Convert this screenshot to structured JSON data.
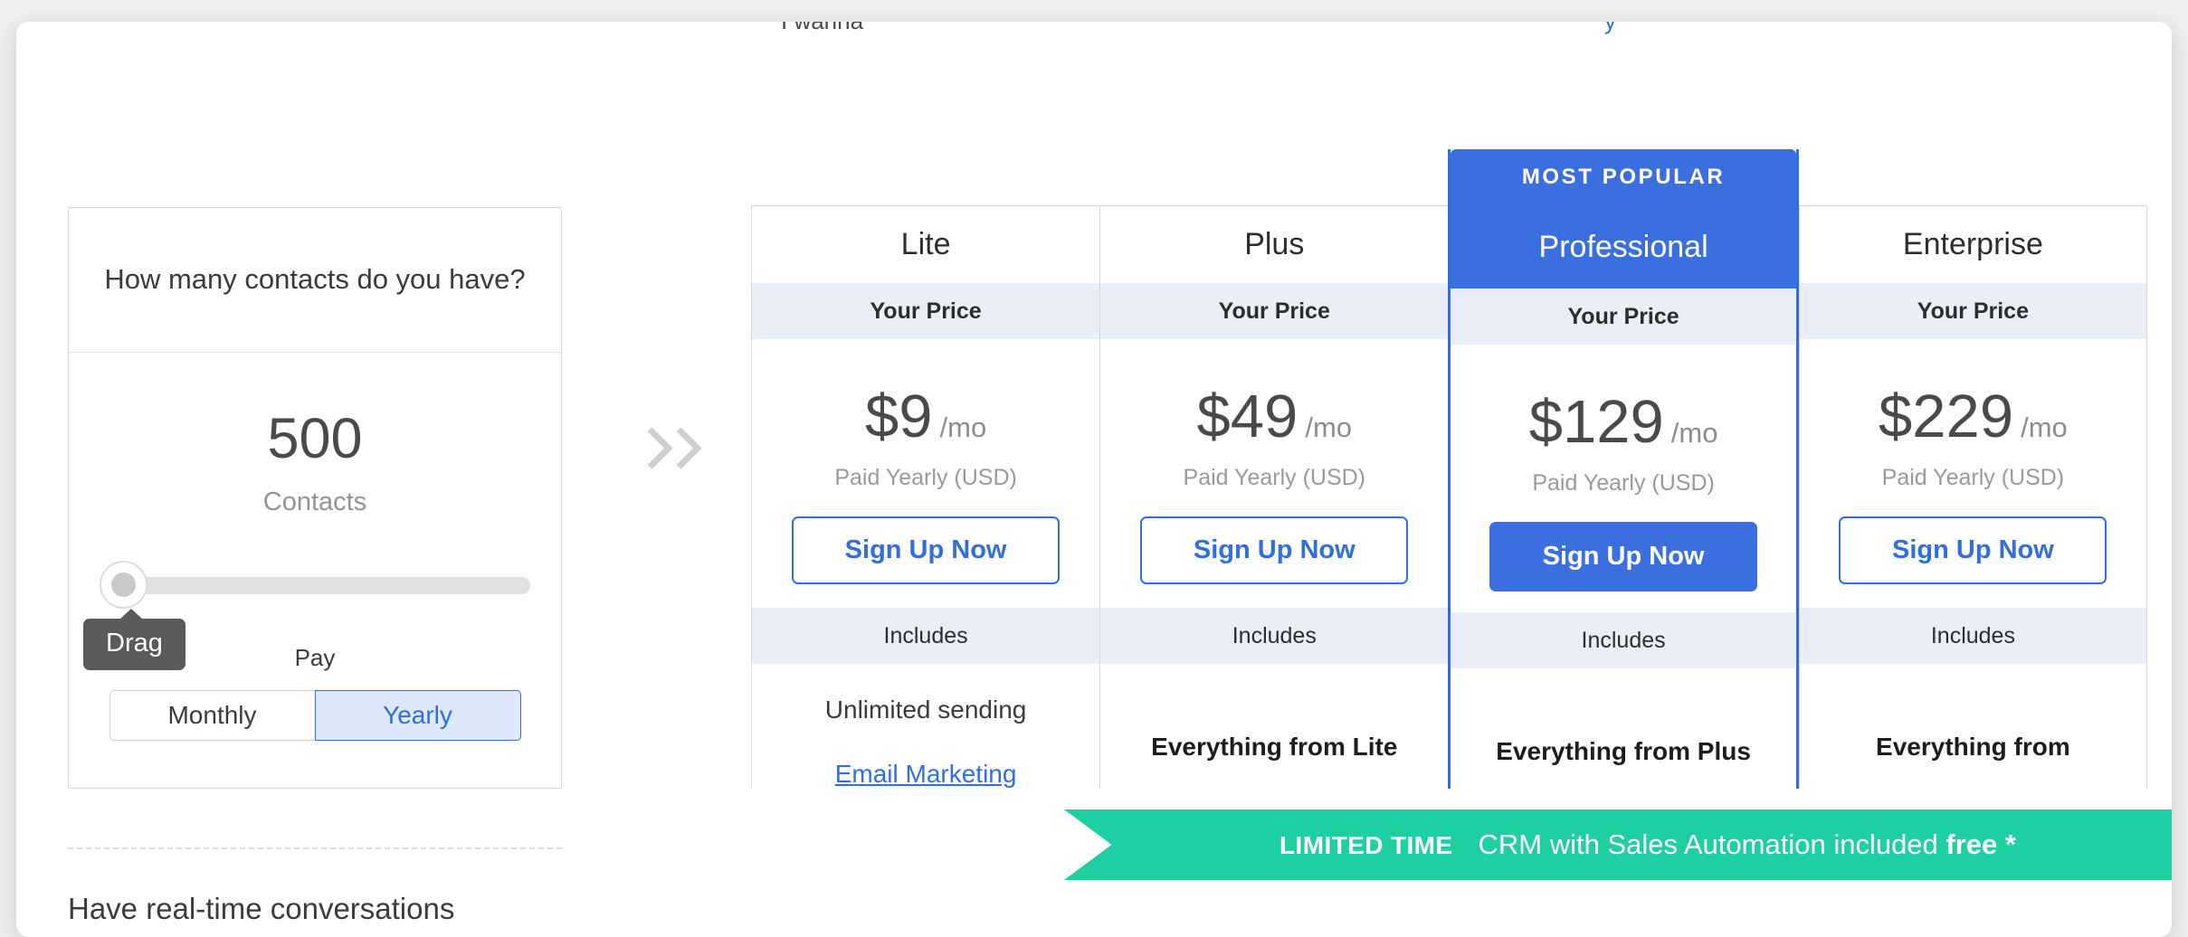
{
  "top_cutoff": {
    "left_fragment": "I wanna",
    "right_fragment": "y"
  },
  "calculator": {
    "question": "How many contacts do you have?",
    "contacts_value": "500",
    "contacts_label": "Contacts",
    "slider": {
      "tooltip": "Drag",
      "position_percent": 0
    },
    "pay": {
      "label": "Pay",
      "options": [
        {
          "label": "Monthly",
          "active": false
        },
        {
          "label": "Yearly",
          "active": true
        }
      ]
    }
  },
  "lower_section": {
    "heading": "Have real-time conversations"
  },
  "arrow": {
    "icon": "double-chevron-right-icon"
  },
  "table": {
    "price_label": "Your Price",
    "includes_label": "Includes",
    "cta_label": "Sign Up Now",
    "most_popular_label": "MOST POPULAR",
    "plans": [
      {
        "name": "Lite",
        "price": "$9",
        "per": "/mo",
        "note": "Paid Yearly (USD)",
        "featured": false,
        "features": [
          {
            "text": "Unlimited sending",
            "type": "plain"
          },
          {
            "text": "Email Marketing",
            "type": "link"
          }
        ]
      },
      {
        "name": "Plus",
        "price": "$49",
        "per": "/mo",
        "note": "Paid Yearly (USD)",
        "featured": false,
        "features": [
          {
            "text": "Everything from Lite",
            "type": "bold"
          }
        ]
      },
      {
        "name": "Professional",
        "price": "$129",
        "per": "/mo",
        "note": "Paid Yearly (USD)",
        "featured": true,
        "features": [
          {
            "text": "Everything from Plus",
            "type": "bold"
          }
        ]
      },
      {
        "name": "Enterprise",
        "price": "$229",
        "per": "/mo",
        "note": "Paid Yearly (USD)",
        "featured": false,
        "features": [
          {
            "text": "Everything from",
            "type": "bold"
          }
        ]
      }
    ]
  },
  "ribbon": {
    "badge": "LIMITED TIME",
    "message_prefix": "CRM with Sales Automation included ",
    "message_bold": "free *"
  },
  "colors": {
    "accent_blue": "#3b6fe0",
    "link_blue": "#2f6fe0",
    "band_gray": "#eaeef7",
    "ribbon_teal": "#1ecfa2",
    "ribbon_fold": "#16a885",
    "tooltip_gray": "#5a5a5a"
  }
}
